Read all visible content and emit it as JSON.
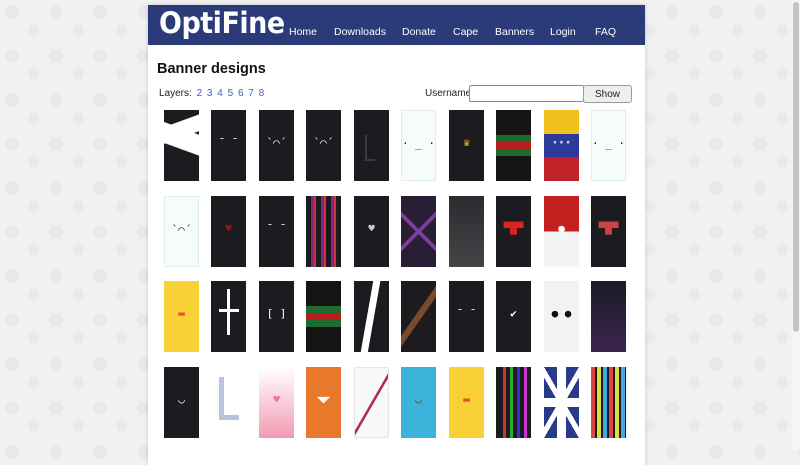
{
  "site": {
    "logo": "OptiFine"
  },
  "nav": {
    "items": [
      "Home",
      "Downloads",
      "Donate",
      "Cape",
      "Banners",
      "Login",
      "FAQ"
    ]
  },
  "page": {
    "title": "Banner designs"
  },
  "layers": {
    "label": "Layers:",
    "pages": [
      "2",
      "3",
      "4",
      "5",
      "6",
      "7",
      "8"
    ]
  },
  "username": {
    "label": "Username",
    "value": "",
    "placeholder": ""
  },
  "show_button": {
    "label": "Show"
  },
  "banners": [
    [
      "black-white-z",
      "black-face",
      "black-sad-face",
      "black-sad-face",
      "black-l",
      "white-face",
      "crown",
      "gucci-stripe",
      "venezuela-flag",
      "white-face"
    ],
    [
      "white-sad-face",
      "bleeding-heart",
      "black-face",
      "purple-red-stripes",
      "cracked-heart",
      "purple-cross",
      "dark-shield",
      "mushroom",
      "pokeball",
      "dark-mushroom"
    ],
    [
      "duck",
      "inverted-cross",
      "bracket-face",
      "gucci-stripe",
      "black-white-lightning",
      "sword",
      "black-face",
      "check",
      "panda",
      "purple-sword"
    ],
    [
      "rice-bowl",
      "blue-l",
      "pink-heart",
      "fox",
      "white-sword",
      "rice-bowl-blue",
      "duck",
      "rainbow-stripes",
      "union-jack",
      "color-blocks"
    ]
  ]
}
